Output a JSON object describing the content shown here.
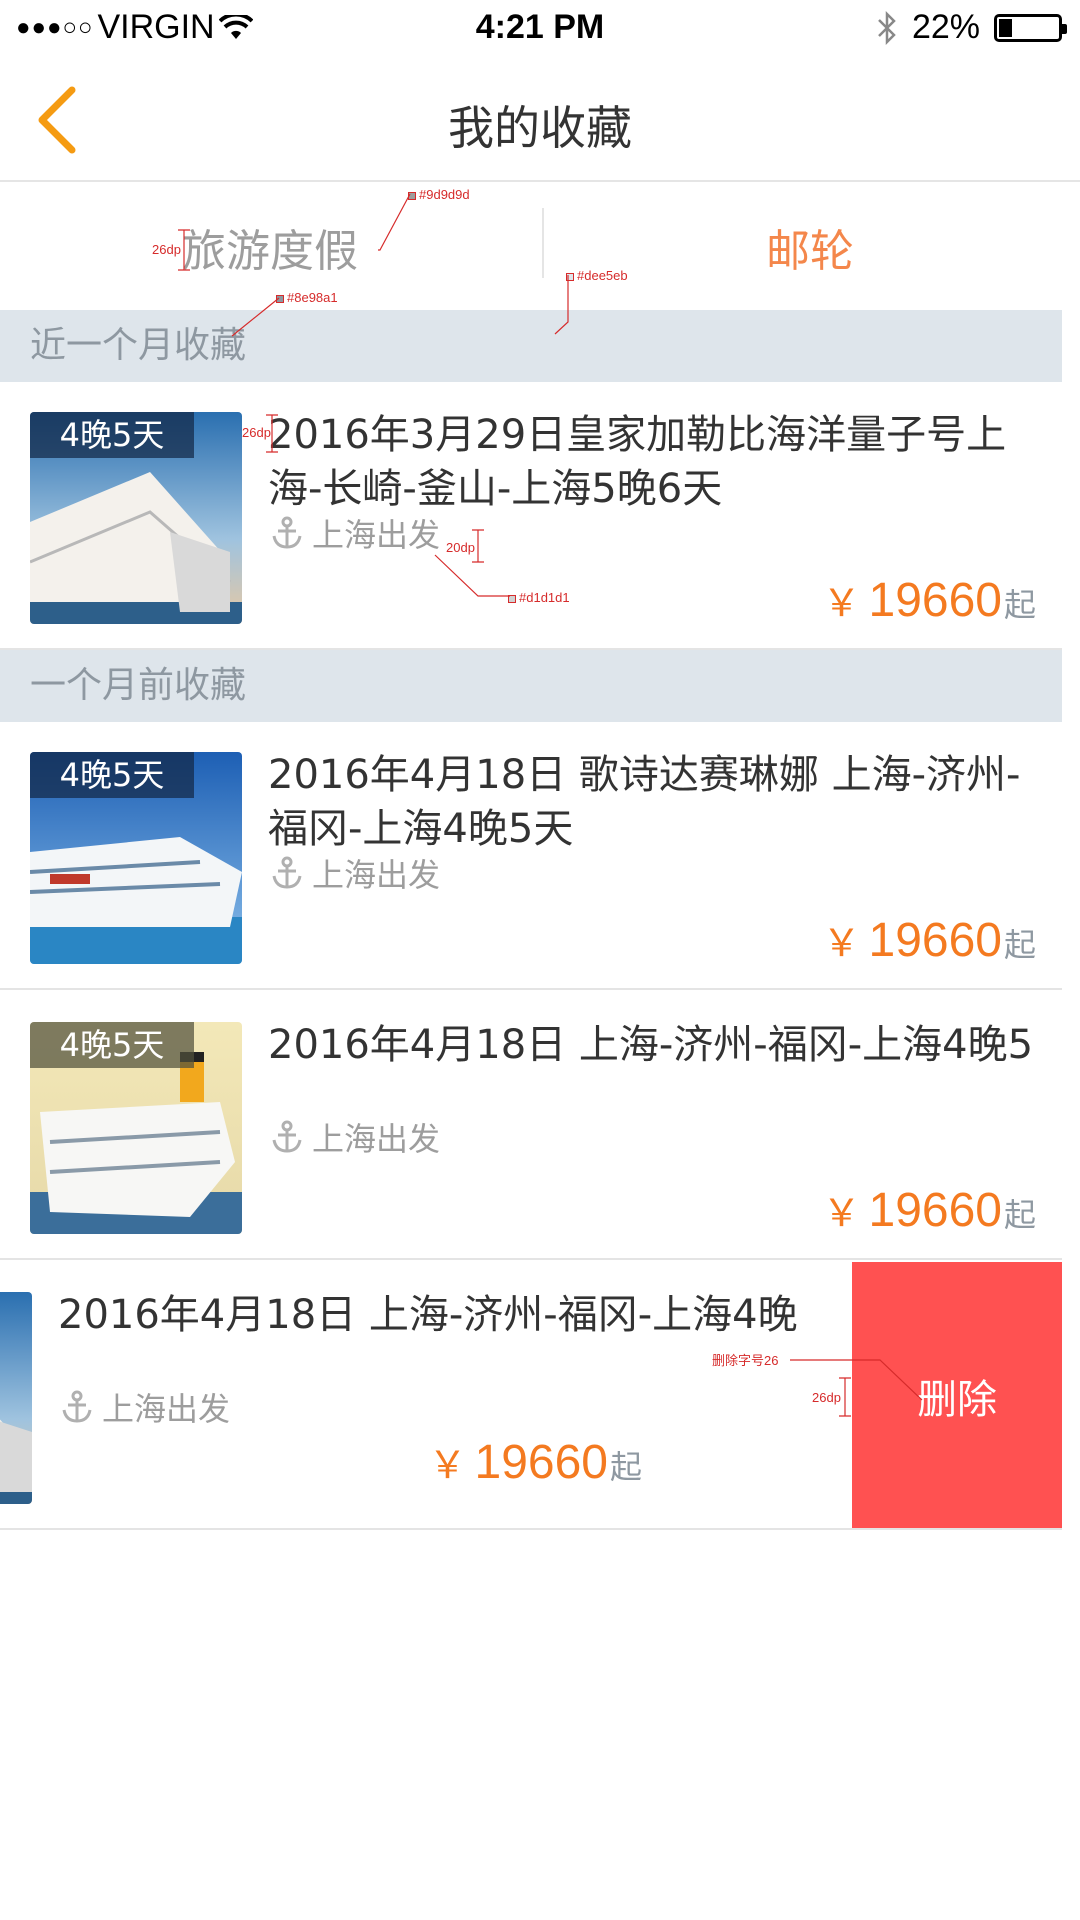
{
  "status_bar": {
    "signal_dots": "●●●○○",
    "carrier": "VIRGIN",
    "time": "4:21 PM",
    "battery": "22%",
    "battery_level": 0.22
  },
  "nav": {
    "title": "我的收藏",
    "back_icon": "chevron-left-icon"
  },
  "tabs": [
    {
      "label": "旅游度假",
      "active": false
    },
    {
      "label": "邮轮",
      "active": true
    }
  ],
  "sections": [
    {
      "label": "近一个月收藏"
    },
    {
      "label": "一个月前收藏"
    }
  ],
  "items": [
    {
      "badge": "4晚5天",
      "title": "2016年3月29日皇家加勒比海洋量子号上海-长崎-釜山-上海5晚6天",
      "origin": "上海出发",
      "price_symbol": "￥",
      "price": "19660",
      "price_suffix": "起"
    },
    {
      "badge": "4晚5天",
      "title": "2016年4月18日 歌诗达赛琳娜 上海-济州-福冈-上海4晚5天",
      "origin": "上海出发",
      "price_symbol": "￥",
      "price": "19660",
      "price_suffix": "起"
    },
    {
      "badge": "4晚5天",
      "title": "2016年4月18日 上海-济州-福冈-上海4晚5",
      "origin": "上海出发",
      "price_symbol": "￥",
      "price": "19660",
      "price_suffix": "起"
    },
    {
      "title": "2016年4月18日 上海-济州-福冈-上海4晚",
      "origin": "上海出发",
      "price_symbol": "￥",
      "price": "19660",
      "price_suffix": "起",
      "delete_label": "删除"
    }
  ],
  "annotations": {
    "tab_color": "#9d9d9d",
    "tab_size": "26dp",
    "section_color": "#8e98a1",
    "section_bg": "#dee5eb",
    "title_size": "26dp",
    "origin_size": "20dp",
    "origin_color": "#d1d1d1",
    "delete_font": "删除字号26",
    "delete_size": "26dp"
  },
  "colors": {
    "accent": "#f4874b",
    "price": "#f47a20",
    "delete_bg": "#ff5151",
    "section_bg": "#dee5eb"
  }
}
